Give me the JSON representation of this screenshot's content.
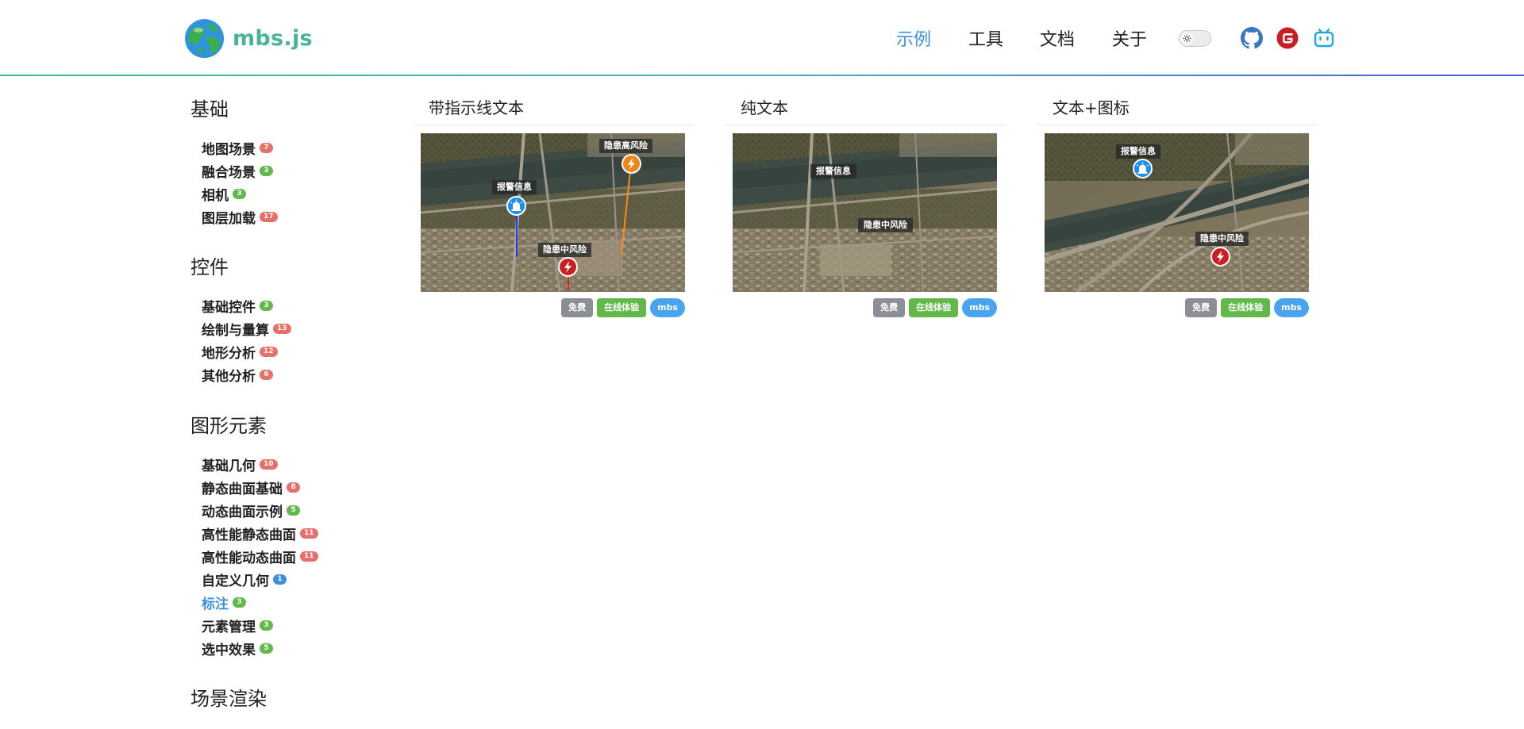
{
  "app": {
    "name": "mbs.js"
  },
  "nav": {
    "items": [
      {
        "label": "示例",
        "active": true
      },
      {
        "label": "工具",
        "active": false
      },
      {
        "label": "文档",
        "active": false
      },
      {
        "label": "关于",
        "active": false
      }
    ],
    "theme_toggle_icon": "sun-icon",
    "external_icons": [
      "github-icon",
      "gitee-icon",
      "bilibili-icon"
    ]
  },
  "sidebar": {
    "sections": [
      {
        "title": "基础",
        "items": [
          {
            "label": "地图场景",
            "count": "7",
            "badge_color": "red"
          },
          {
            "label": "融合场景",
            "count": "3",
            "badge_color": "green"
          },
          {
            "label": "相机",
            "count": "3",
            "badge_color": "green"
          },
          {
            "label": "图层加载",
            "count": "17",
            "badge_color": "red"
          }
        ]
      },
      {
        "title": "控件",
        "items": [
          {
            "label": "基础控件",
            "count": "3",
            "badge_color": "green"
          },
          {
            "label": "绘制与量算",
            "count": "13",
            "badge_color": "red"
          },
          {
            "label": "地形分析",
            "count": "12",
            "badge_color": "red"
          },
          {
            "label": "其他分析",
            "count": "6",
            "badge_color": "red"
          }
        ]
      },
      {
        "title": "图形元素",
        "items": [
          {
            "label": "基础几何",
            "count": "10",
            "badge_color": "red"
          },
          {
            "label": "静态曲面基础",
            "count": "8",
            "badge_color": "red"
          },
          {
            "label": "动态曲面示例",
            "count": "5",
            "badge_color": "green"
          },
          {
            "label": "高性能静态曲面",
            "count": "11",
            "badge_color": "red"
          },
          {
            "label": "高性能动态曲面",
            "count": "11",
            "badge_color": "red"
          },
          {
            "label": "自定义几何",
            "count": "1",
            "badge_color": "blue"
          },
          {
            "label": "标注",
            "count": "3",
            "badge_color": "green",
            "active": true
          },
          {
            "label": "元素管理",
            "count": "3",
            "badge_color": "green"
          },
          {
            "label": "选中效果",
            "count": "5",
            "badge_color": "green"
          }
        ]
      },
      {
        "title": "场景渲染",
        "items": []
      }
    ]
  },
  "cards": [
    {
      "title": "带指示线文本",
      "labels": [
        "报警信息",
        "隐患高风险",
        "隐患中风险"
      ],
      "tags": [
        "免费",
        "在线体验",
        "mbs"
      ]
    },
    {
      "title": "纯文本",
      "labels": [
        "报警信息",
        "隐患中风险"
      ],
      "tags": [
        "免费",
        "在线体验",
        "mbs"
      ]
    },
    {
      "title": "文本+图标",
      "labels": [
        "报警信息",
        "隐患中风险"
      ],
      "tags": [
        "免费",
        "在线体验",
        "mbs"
      ]
    }
  ],
  "colors": {
    "accent": "#3b8fe0",
    "badge_red": "#e8706b",
    "badge_green": "#63b84a",
    "tag_gray": "#8b8e94",
    "tag_blue": "#4aa3ee"
  }
}
